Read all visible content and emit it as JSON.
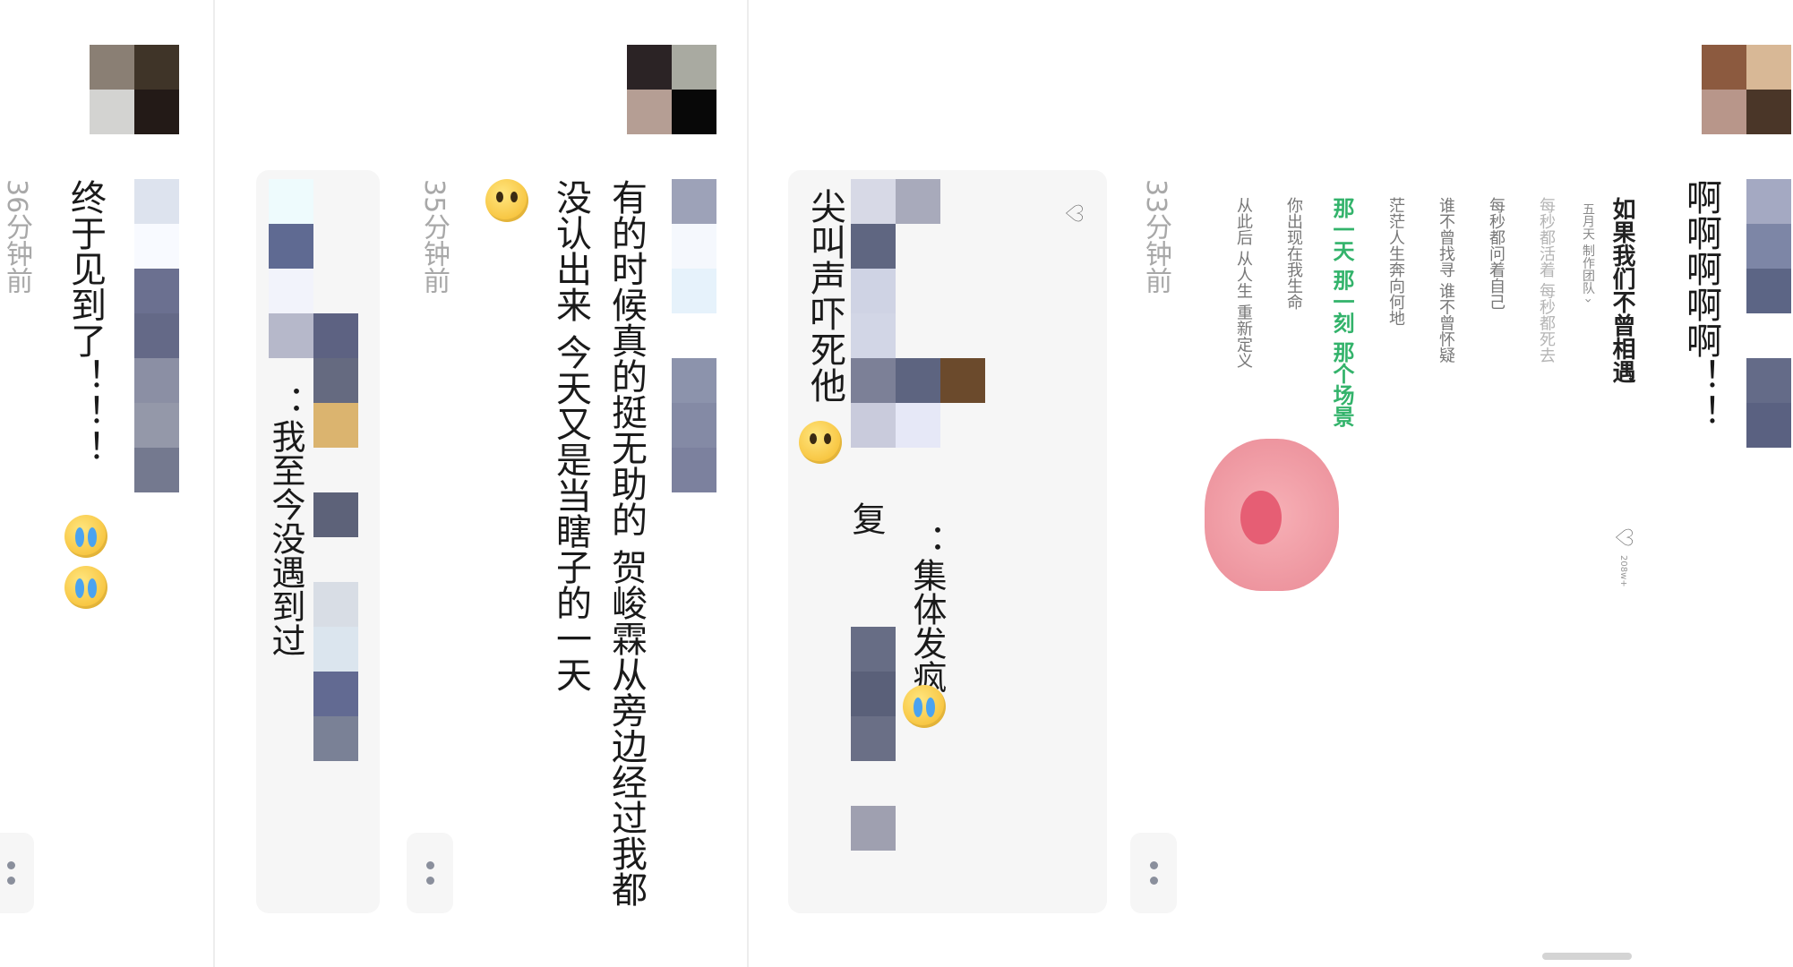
{
  "comments": [
    {
      "id": "c1",
      "text": "啊啊啊啊啊！！",
      "time": "33分钟前",
      "shared_post": {
        "title": "如果我们不曾相遇",
        "artist": "五月天  制作团队 ›",
        "lyrics": [
          "每秒都活着 每秒都死去",
          "每秒都问着自己",
          "谁不曾找寻 谁不曾怀疑",
          "茫茫人生奔向何地",
          "那一天 那一刻 那个场景",
          "你出现在我生命",
          "从此后 从人生 重新定义"
        ],
        "like_count": "208w+",
        "highlight_color": "#33b36b"
      }
    },
    {
      "id": "c2",
      "reply_text": "：集体发疯",
      "reply_text_2": "复",
      "text": "尖叫声吓死他",
      "emoji_name": "scream-cat-emoji",
      "like_icon": "heart-outline-icon"
    },
    {
      "id": "c3",
      "text": "有的时候真的挺无助的 贺峻霖从旁边经过我都没认出来 今天又是当瞎子的一天",
      "time": "35分钟前",
      "reply_text": "：我至今没遇到过"
    },
    {
      "id": "c4",
      "text": "终于见到了！！！",
      "time": "36分钟前"
    }
  ],
  "icons": {
    "more": "more-dots-icon",
    "heart": "heart-outline-icon",
    "emoji_smile": "smile-emoji",
    "emoji_cry": "crying-emoji"
  },
  "colors": {
    "time_text": "#a8a8a8",
    "card_bg": "#f6f6f6",
    "lyric_highlight": "#33b36b"
  }
}
